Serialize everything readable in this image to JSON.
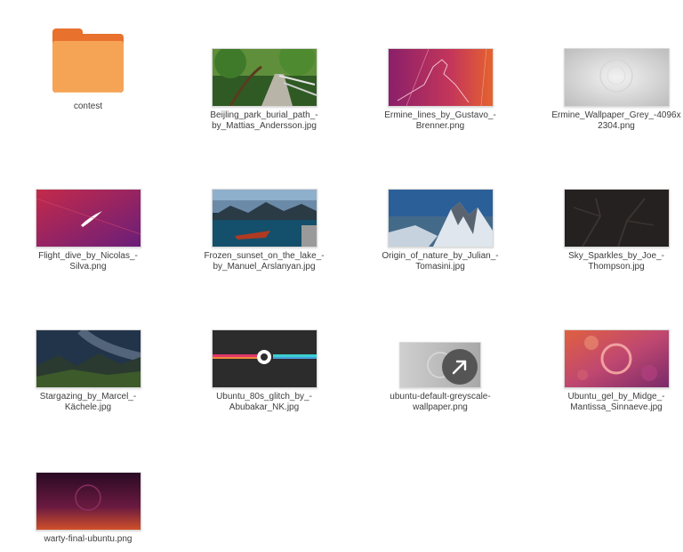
{
  "files": [
    {
      "name": "contest",
      "type": "folder",
      "icon": "folder-icon"
    },
    {
      "name": "Beijling_park_burial_path_-by_Mattias_Andersson.jpg",
      "type": "image"
    },
    {
      "name": "Ermine_lines_by_Gustavo_-Brenner.png",
      "type": "image"
    },
    {
      "name": "Ermine_Wallpaper_Grey_-4096x2304.png",
      "type": "image"
    },
    {
      "name": "Flight_dive_by_Nicolas_-Silva.png",
      "type": "image"
    },
    {
      "name": "Frozen_sunset_on_the_lake_-by_Manuel_Arslanyan.jpg",
      "type": "image"
    },
    {
      "name": "Origin_of_nature_by_Julian_-Tomasini.jpg",
      "type": "image"
    },
    {
      "name": "Sky_Sparkles_by_Joe_-Thompson.jpg",
      "type": "image"
    },
    {
      "name": "Stargazing_by_Marcel_-Kächele.jpg",
      "type": "image"
    },
    {
      "name": "Ubuntu_80s_glitch_by_-Abubakar_NK.jpg",
      "type": "image"
    },
    {
      "name": "ubuntu-default-greyscale-wallpaper.png",
      "type": "symlink",
      "icon": "symlink-arrow-icon"
    },
    {
      "name": "Ubuntu_gel_by_Midge_-Mantissa_Sinnaeve.jpg",
      "type": "image"
    },
    {
      "name": "warty-final-ubuntu.png",
      "type": "image"
    }
  ],
  "colors": {
    "folder": "#f5a455",
    "folder_dark": "#e8712d",
    "label": "#3d3d3d",
    "background": "#ffffff"
  }
}
